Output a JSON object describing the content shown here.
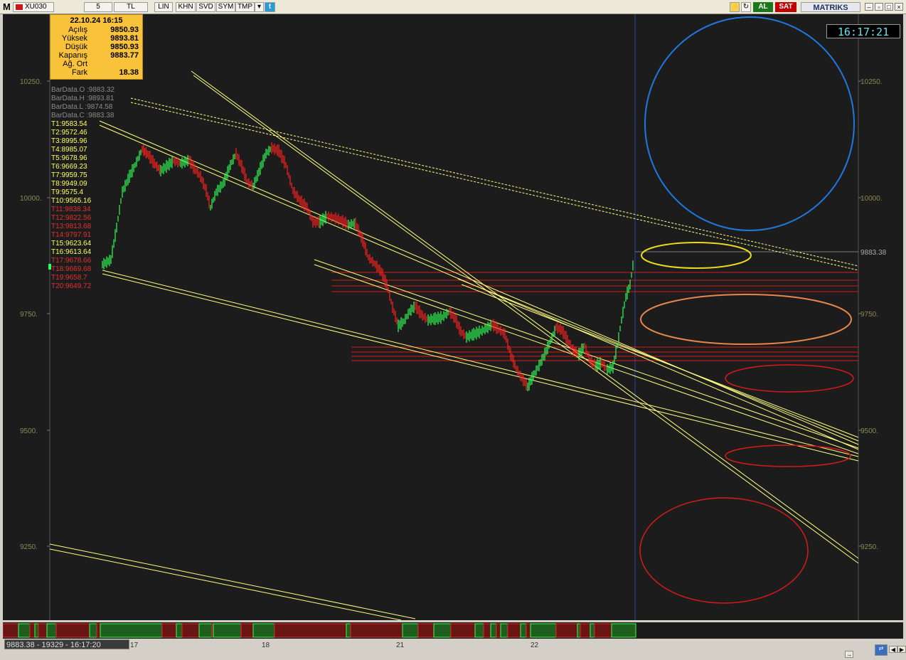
{
  "toolbar": {
    "logo": "M",
    "symbol": "XU030",
    "period": "5",
    "currency": "TL",
    "buttons": [
      "LIN",
      "KHN",
      "SVD",
      "SYM",
      "TMP"
    ],
    "al_label": "AL",
    "sat_label": "SAT",
    "brand": "MATRIKS"
  },
  "clock": "16:17:21",
  "info_box": {
    "datetime": "22.10.24 16:15",
    "rows": [
      {
        "label": "Açılış",
        "value": "9850.93"
      },
      {
        "label": "Yüksek",
        "value": "9893.81"
      },
      {
        "label": "Düşük",
        "value": "9850.93"
      },
      {
        "label": "Kapanış",
        "value": "9883.77"
      },
      {
        "label": "Ağ. Ort",
        "value": ""
      },
      {
        "label": "Fark",
        "value": "18.38"
      }
    ]
  },
  "bar_data": [
    "BarData.O :9883.32",
    "BarData.H :9893.81",
    "BarData.L :9874.58",
    "BarData.C :9883.38"
  ],
  "t_levels": [
    {
      "text": "T1:9583.54",
      "color": "#ffff66"
    },
    {
      "text": "T2:9572.46",
      "color": "#ffff66"
    },
    {
      "text": "T3:8995.96",
      "color": "#ffff66"
    },
    {
      "text": "T4:8985.07",
      "color": "#ffff66"
    },
    {
      "text": "T5:9678.96",
      "color": "#ffff66"
    },
    {
      "text": "T6:9669.23",
      "color": "#ffff66"
    },
    {
      "text": "T7:9959.75",
      "color": "#ffff66"
    },
    {
      "text": "T8:9949.09",
      "color": "#ffff66"
    },
    {
      "text": "T9:9575.4",
      "color": "#ffff66"
    },
    {
      "text": "T10:9565.16",
      "color": "#ffff66"
    },
    {
      "text": "T11:9838.34",
      "color": "#e23030"
    },
    {
      "text": "T12:9822.56",
      "color": "#e23030"
    },
    {
      "text": "T13:9813.68",
      "color": "#e23030"
    },
    {
      "text": "T14:9797.91",
      "color": "#e23030"
    },
    {
      "text": "T15:9623.64",
      "color": "#ffff66"
    },
    {
      "text": "T16:9613.64",
      "color": "#ffff66"
    },
    {
      "text": "T17:9678.66",
      "color": "#e23030"
    },
    {
      "text": "T18:9669.68",
      "color": "#e23030"
    },
    {
      "text": "T19:9658.7",
      "color": "#e23030"
    },
    {
      "text": "T20:9649.72",
      "color": "#e23030"
    }
  ],
  "y_axis": {
    "labels": [
      "10250.",
      "10000.",
      "9750.",
      "9500.",
      "9250."
    ],
    "last_price_label": "9883.38"
  },
  "x_axis": {
    "labels": [
      "17",
      "18",
      "21",
      "22"
    ]
  },
  "status_text": "9883.38 - 19329 - 16:17:20",
  "colors": {
    "up": "#2dff56",
    "down": "#ff2020",
    "trend": "#ffff80",
    "background": "#1c1c1c",
    "axis_text": "#8a8a55"
  }
}
